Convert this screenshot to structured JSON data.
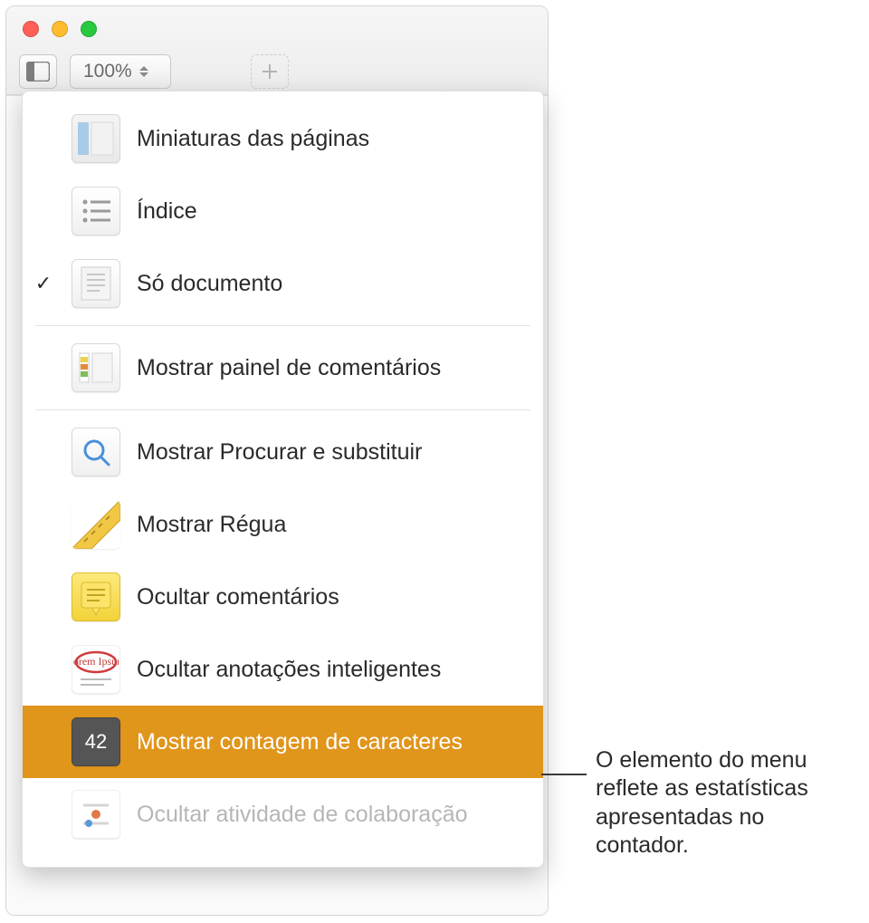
{
  "toolbar": {
    "zoom_value": "100%"
  },
  "menu": {
    "items": {
      "thumbnails": "Miniaturas das páginas",
      "index": "Índice",
      "doc_only": "Só documento",
      "comments_panel": "Mostrar painel de comentários",
      "find_replace": "Mostrar Procurar e substituir",
      "ruler": "Mostrar Régua",
      "hide_comments": "Ocultar comentários",
      "hide_annotations": "Ocultar anotações inteligentes",
      "char_count": "Mostrar contagem de caracteres",
      "hide_collab": "Ocultar atividade de colaboração"
    },
    "count_badge": "42",
    "annotation_sample": "Lorem Ipsum"
  },
  "callout": "O elemento do menu reflete as estatísticas apresentadas no contador."
}
